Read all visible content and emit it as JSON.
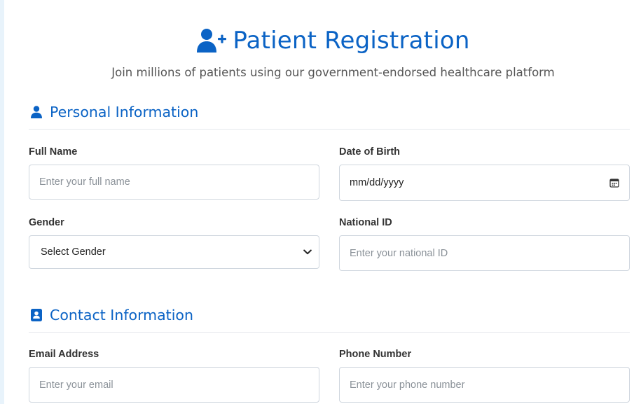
{
  "header": {
    "title": "Patient Registration",
    "title_icon": "user-plus-icon",
    "subtitle": "Join millions of patients using our government-endorsed healthcare platform"
  },
  "sections": {
    "personal": {
      "title": "Personal Information",
      "icon": "user-icon",
      "fields": {
        "full_name": {
          "label": "Full Name",
          "placeholder": "Enter your full name"
        },
        "dob": {
          "label": "Date of Birth",
          "value": "mm/dd/yyyy",
          "icon": "calendar-icon"
        },
        "gender": {
          "label": "Gender",
          "selected": "Select Gender",
          "icon": "chevron-down-icon"
        },
        "national_id": {
          "label": "National ID",
          "placeholder": "Enter your national ID"
        }
      }
    },
    "contact": {
      "title": "Contact Information",
      "icon": "address-book-icon",
      "fields": {
        "email": {
          "label": "Email Address",
          "placeholder": "Enter your email"
        },
        "phone": {
          "label": "Phone Number",
          "placeholder": "Enter your phone number"
        }
      }
    }
  },
  "colors": {
    "accent": "#0b63c5",
    "border": "#cfd6de",
    "placeholder": "#8a9198"
  }
}
